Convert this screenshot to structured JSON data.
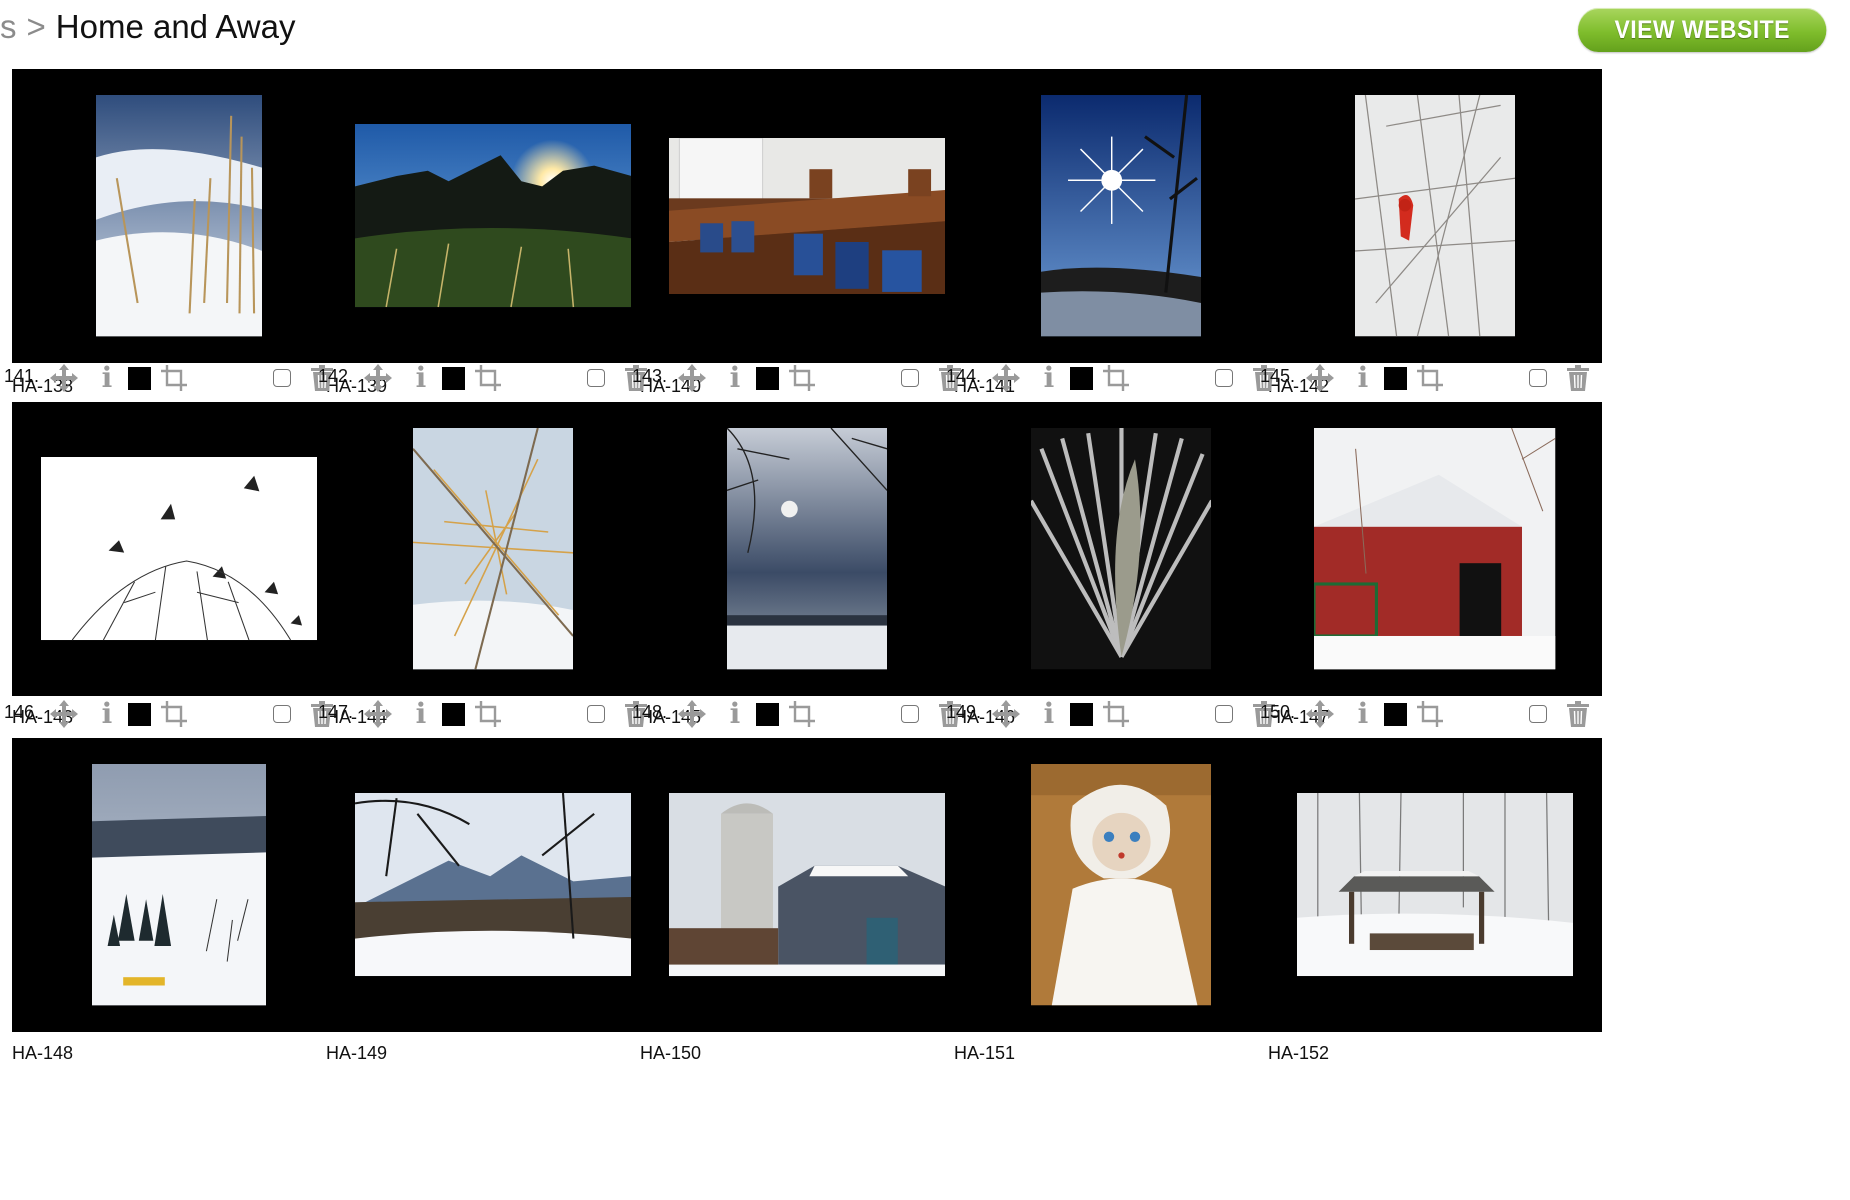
{
  "breadcrumb": {
    "previous": "s",
    "separator": ">",
    "current": "Home and Away"
  },
  "header": {
    "view_website_label": "VIEW WEBSITE"
  },
  "rows": [
    {
      "items": [
        {
          "caption": "HA-138",
          "photo": "frozen-lake-cattails"
        },
        {
          "caption": "HA-139",
          "photo": "badlands-sunburst"
        },
        {
          "caption": "HA-140",
          "photo": "church-pew-hymnals"
        },
        {
          "caption": "HA-141",
          "photo": "sunstar-over-marsh"
        },
        {
          "caption": "HA-142",
          "photo": "cardinal-in-branches"
        }
      ]
    },
    {
      "items": [
        {
          "number": "141.",
          "caption": "HA-143",
          "photo": "geese-over-trees"
        },
        {
          "number": "142.",
          "caption": "HA-144",
          "photo": "larch-branch-snow"
        },
        {
          "number": "143.",
          "caption": "HA-145",
          "photo": "stormy-sky-branches"
        },
        {
          "number": "144.",
          "caption": "HA-146",
          "photo": "turkey-feather-fan"
        },
        {
          "number": "145.",
          "caption": "HA-147",
          "photo": "red-barn-snow"
        }
      ]
    },
    {
      "items": [
        {
          "number": "146.",
          "caption": "HA-148",
          "photo": "snowy-valley"
        },
        {
          "number": "147.",
          "caption": "HA-149",
          "photo": "mountain-view-snow"
        },
        {
          "number": "148.",
          "caption": "HA-150",
          "photo": "silo-barn-winter"
        },
        {
          "number": "149.",
          "caption": "HA-151",
          "photo": "antique-doll"
        },
        {
          "number": "150.",
          "caption": "HA-152",
          "photo": "snowy-shelter-woods"
        }
      ]
    }
  ],
  "icons": {
    "move": "move-arrows-icon",
    "info": "info-icon",
    "swatch": "black-swatch-icon",
    "crop": "crop-icon",
    "select": "checkbox-icon",
    "delete": "trash-icon"
  },
  "colors": {
    "button_green": "#7fbd2c",
    "frame": "#000000",
    "icon_gray": "#9a9a9a"
  }
}
